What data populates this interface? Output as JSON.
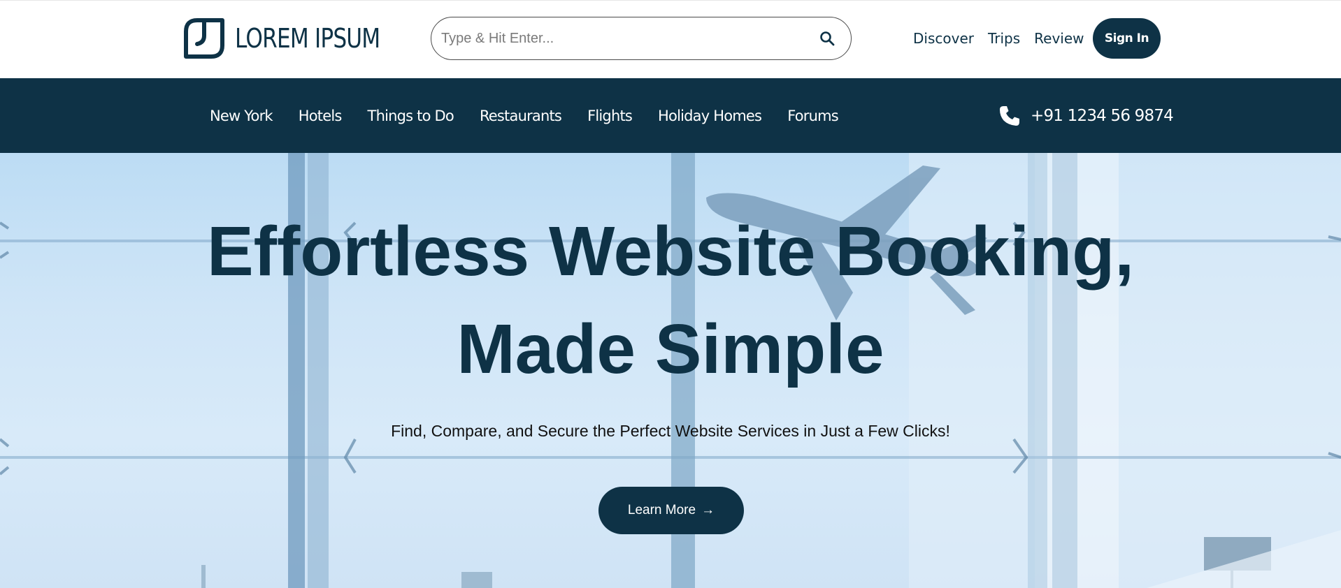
{
  "brand": {
    "name": "LOREM IPSUM"
  },
  "search": {
    "placeholder": "Type & Hit Enter...",
    "value": ""
  },
  "top_links": [
    "Discover",
    "Trips",
    "Review"
  ],
  "signin_label": "Sign In",
  "nav": {
    "items": [
      "New York",
      "Hotels",
      "Things to Do",
      "Restaurants",
      "Flights",
      "Holiday Homes",
      "Forums"
    ],
    "phone": "+91 1234 56 9874"
  },
  "hero": {
    "title_line1": "Effortless Website Booking,",
    "title_line2": "Made Simple",
    "subtitle": "Find, Compare, and Secure the Perfect Website Services in Just a Few Clicks!",
    "cta_label": "Learn More",
    "cta_arrow": "→"
  },
  "colors": {
    "primary": "#0e3246",
    "hero_bg": "#cfe5f7",
    "white": "#ffffff"
  },
  "icons": {
    "search": "search-icon",
    "phone": "phone-icon",
    "logo": "leaf-logo-icon",
    "arrow": "arrow-right-icon"
  }
}
